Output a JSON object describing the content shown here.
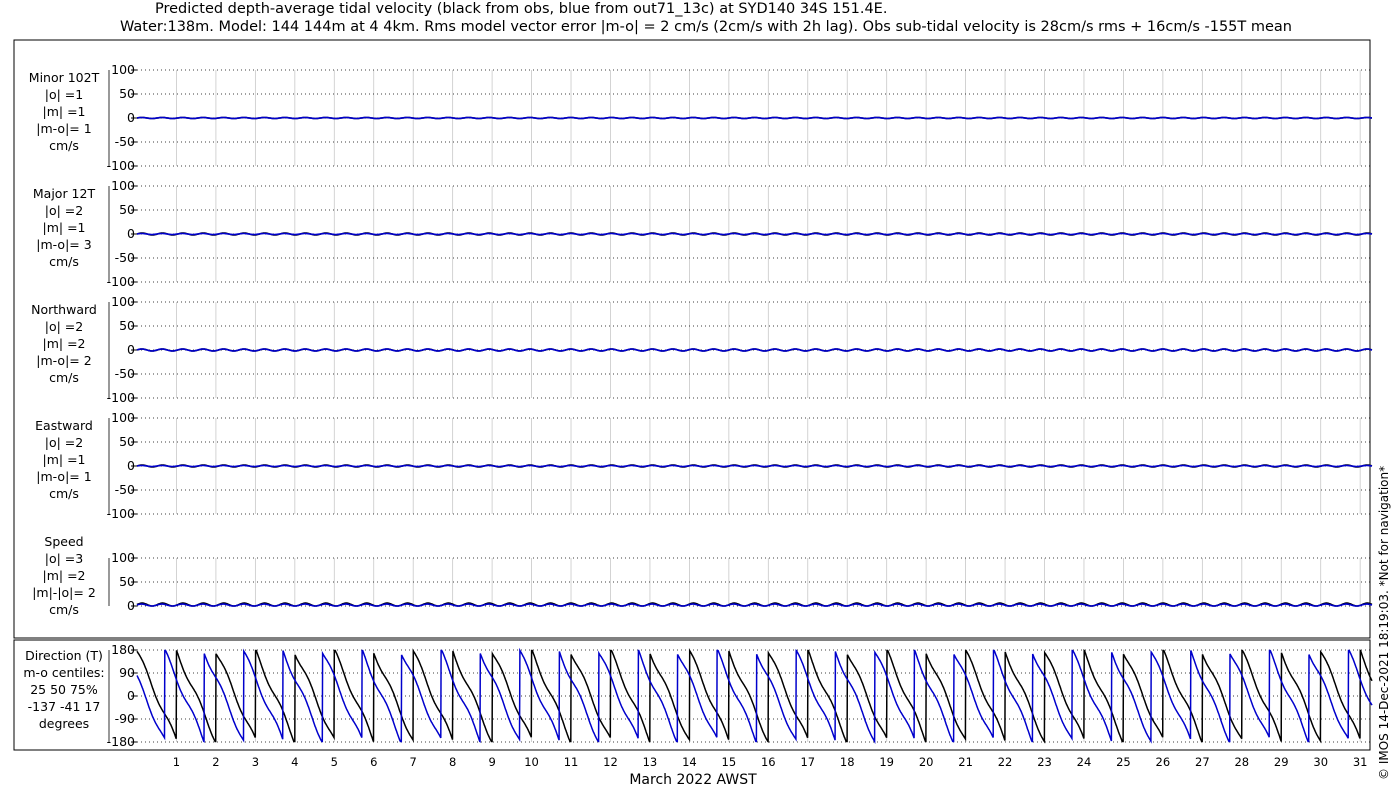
{
  "title_line1": "Predicted depth-average tidal velocity (black from obs, blue from out71_13c) at SYD140 34S 151.4E.",
  "title_line2": "Water:138m. Model: 144 144m at 4 4km. Rms model vector error |m-o| = 2 cm/s (2cm/s with 2h lag). Obs sub-tidal velocity is 28cm/s rms + 16cm/s -155T mean",
  "xlabel": "March 2022 AWST",
  "side_note": "© IMOS 14-Dec-2021 18:19:03.  *Not for navigation*",
  "colors": {
    "obs": "#000000",
    "model": "#0000cc",
    "grid": "#b0b0b0"
  },
  "chart_data": [
    {
      "type": "line",
      "panel": "minor",
      "label_lines": [
        "Minor 102T",
        "|o| =1",
        "|m| =1",
        "|m-o|= 1",
        "cm/s"
      ],
      "ylim": [
        -100,
        100
      ],
      "yticks": [
        "100",
        "50",
        "0",
        "-50",
        "-100"
      ],
      "ytick_values": [
        100,
        50,
        0,
        -50,
        -100
      ],
      "xlim": [
        0,
        31.3
      ],
      "x_ticks": [
        "1",
        "2",
        "3",
        "4",
        "5",
        "6",
        "7",
        "8",
        "9",
        "10",
        "11",
        "12",
        "13",
        "14",
        "15",
        "16",
        "17",
        "18",
        "19",
        "20",
        "21",
        "22",
        "23",
        "24",
        "25",
        "26",
        "27",
        "28",
        "29",
        "30",
        "31"
      ],
      "series": [
        {
          "color": "obs",
          "amplitude": 1,
          "phase": 0.0,
          "period_days": 0.5175
        },
        {
          "color": "model",
          "amplitude": 1,
          "phase": 0.15,
          "period_days": 0.5175
        }
      ]
    },
    {
      "type": "line",
      "panel": "major",
      "label_lines": [
        "Major 12T",
        "|o| =2",
        "|m| =1",
        "|m-o|= 3",
        "cm/s"
      ],
      "ylim": [
        -100,
        100
      ],
      "yticks": [
        "100",
        "50",
        "0",
        "-50",
        "-100"
      ],
      "ytick_values": [
        100,
        50,
        0,
        -50,
        -100
      ],
      "xlim": [
        0,
        31.3
      ],
      "x_ticks": [],
      "series": [
        {
          "color": "obs",
          "amplitude": 2,
          "phase": 0.0,
          "period_days": 0.5175
        },
        {
          "color": "model",
          "amplitude": 1,
          "phase": 0.15,
          "period_days": 0.5175
        }
      ]
    },
    {
      "type": "line",
      "panel": "north",
      "label_lines": [
        "Northward",
        "|o| =2",
        "|m| =2",
        "|m-o|= 2",
        "cm/s"
      ],
      "ylim": [
        -100,
        100
      ],
      "yticks": [
        "100",
        "50",
        "0",
        "-50",
        "-100"
      ],
      "ytick_values": [
        100,
        50,
        0,
        -50,
        -100
      ],
      "xlim": [
        0,
        31.3
      ],
      "x_ticks": [],
      "series": [
        {
          "color": "obs",
          "amplitude": 2,
          "phase": 0.0,
          "period_days": 0.5175
        },
        {
          "color": "model",
          "amplitude": 2,
          "phase": 0.15,
          "period_days": 0.5175
        }
      ]
    },
    {
      "type": "line",
      "panel": "east",
      "label_lines": [
        "Eastward",
        "|o| =2",
        "|m| =1",
        "|m-o|= 1",
        "cm/s"
      ],
      "ylim": [
        -100,
        100
      ],
      "yticks": [
        "100",
        "50",
        "0",
        "-50",
        "-100"
      ],
      "ytick_values": [
        100,
        50,
        0,
        -50,
        -100
      ],
      "xlim": [
        0,
        31.3
      ],
      "x_ticks": [],
      "series": [
        {
          "color": "obs",
          "amplitude": 2,
          "phase": 0.0,
          "period_days": 0.5175
        },
        {
          "color": "model",
          "amplitude": 1,
          "phase": 0.15,
          "period_days": 0.5175
        }
      ]
    },
    {
      "type": "line",
      "panel": "speed",
      "label_lines": [
        "Speed",
        "|o| =3",
        "|m| =2",
        "|m|-|o|= 2",
        "cm/s"
      ],
      "ylim": [
        0,
        100
      ],
      "yticks": [
        "100",
        "50",
        "0"
      ],
      "ytick_values": [
        100,
        50,
        0
      ],
      "xlim": [
        0,
        31.3
      ],
      "x_ticks": [],
      "series": [
        {
          "color": "obs",
          "amplitude": 3,
          "phase": 0.0,
          "period_days": 0.5175
        },
        {
          "color": "model",
          "amplitude": 2,
          "phase": 0.15,
          "period_days": 0.5175
        }
      ]
    },
    {
      "type": "line",
      "panel": "direction",
      "label_lines": [
        "Direction (T)",
        "m-o centiles:",
        "25  50  75%",
        "-137  -41   17",
        "degrees"
      ],
      "ylim": [
        -180,
        180
      ],
      "yticks": [
        "180",
        "90",
        "0",
        "-90",
        "-180"
      ],
      "ytick_values": [
        180,
        90,
        0,
        -90,
        -180
      ],
      "xlim": [
        0,
        31.3
      ],
      "x_ticks": [
        "1",
        "2",
        "3",
        "4",
        "5",
        "6",
        "7",
        "8",
        "9",
        "10",
        "11",
        "12",
        "13",
        "14",
        "15",
        "16",
        "17",
        "18",
        "19",
        "20",
        "21",
        "22",
        "23",
        "24",
        "25",
        "26",
        "27",
        "28",
        "29",
        "30",
        "31"
      ],
      "series": [
        {
          "color": "obs",
          "type": "sawtooth",
          "period_days": 1.0
        },
        {
          "color": "model",
          "type": "sawtooth",
          "period_days": 1.0,
          "lag_days": 0.3
        }
      ]
    }
  ]
}
